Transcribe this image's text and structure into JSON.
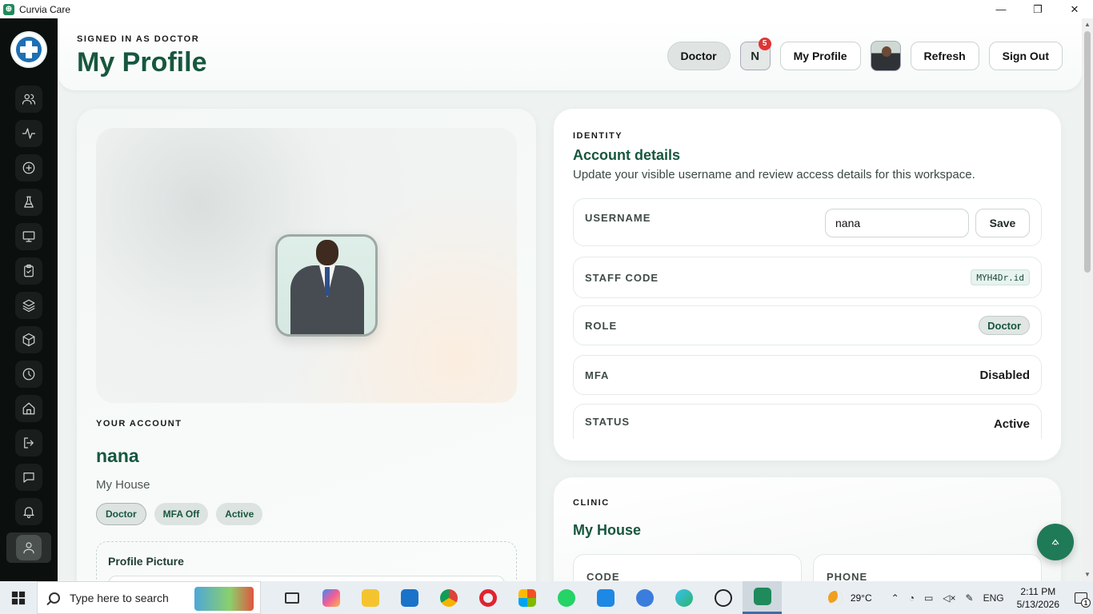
{
  "window": {
    "title": "Curvia Care",
    "minimize": "—",
    "maximize": "❐",
    "close": "✕"
  },
  "sidebar": {
    "items": [
      {
        "name": "patients",
        "icon": "users-icon"
      },
      {
        "name": "vitals",
        "icon": "activity-icon"
      },
      {
        "name": "add",
        "icon": "plus-circle-icon"
      },
      {
        "name": "lab",
        "icon": "flask-icon"
      },
      {
        "name": "monitor",
        "icon": "monitor-icon"
      },
      {
        "name": "tasks",
        "icon": "clipboard-icon"
      },
      {
        "name": "layers",
        "icon": "layers-icon"
      },
      {
        "name": "inventory",
        "icon": "box-icon"
      },
      {
        "name": "history",
        "icon": "clock-icon"
      },
      {
        "name": "home",
        "icon": "home-icon"
      },
      {
        "name": "logout",
        "icon": "logout-icon"
      },
      {
        "name": "messages",
        "icon": "chat-icon"
      },
      {
        "name": "alerts",
        "icon": "bell-icon"
      },
      {
        "name": "profile",
        "icon": "user-icon",
        "active": true
      }
    ]
  },
  "header": {
    "eyebrow": "SIGNED IN AS DOCTOR",
    "title": "My Profile",
    "role_label": "Doctor",
    "notif_initial": "N",
    "notif_count": "5",
    "my_profile_label": "My Profile",
    "refresh_label": "Refresh",
    "signout_label": "Sign Out"
  },
  "account": {
    "eyebrow": "YOUR ACCOUNT",
    "name": "nana",
    "org": "My House",
    "chips": [
      "Doctor",
      "MFA Off",
      "Active"
    ],
    "picture_title": "Profile Picture"
  },
  "identity": {
    "eyebrow": "IDENTITY",
    "title": "Account details",
    "subtitle": "Update your visible username and review access details for this workspace.",
    "username_label": "USERNAME",
    "username_value": "nana",
    "save_label": "Save",
    "staff_code_label": "STAFF CODE",
    "staff_code_value": "MYH4Dr.id",
    "role_label": "ROLE",
    "role_value": "Doctor",
    "mfa_label": "MFA",
    "mfa_value": "Disabled",
    "status_label": "STATUS",
    "status_value": "Active"
  },
  "clinic": {
    "eyebrow": "CLINIC",
    "title": "My House",
    "code_label": "CODE",
    "phone_label": "PHONE"
  },
  "taskbar": {
    "search_placeholder": "Type here to search",
    "weather": "29°C",
    "lang": "ENG",
    "time": "2:11 PM",
    "date": "5/13/2026",
    "notif_count": "1"
  },
  "colors": {
    "brand": "#17573e",
    "accent": "#1f7a57",
    "badge": "#e03434"
  }
}
